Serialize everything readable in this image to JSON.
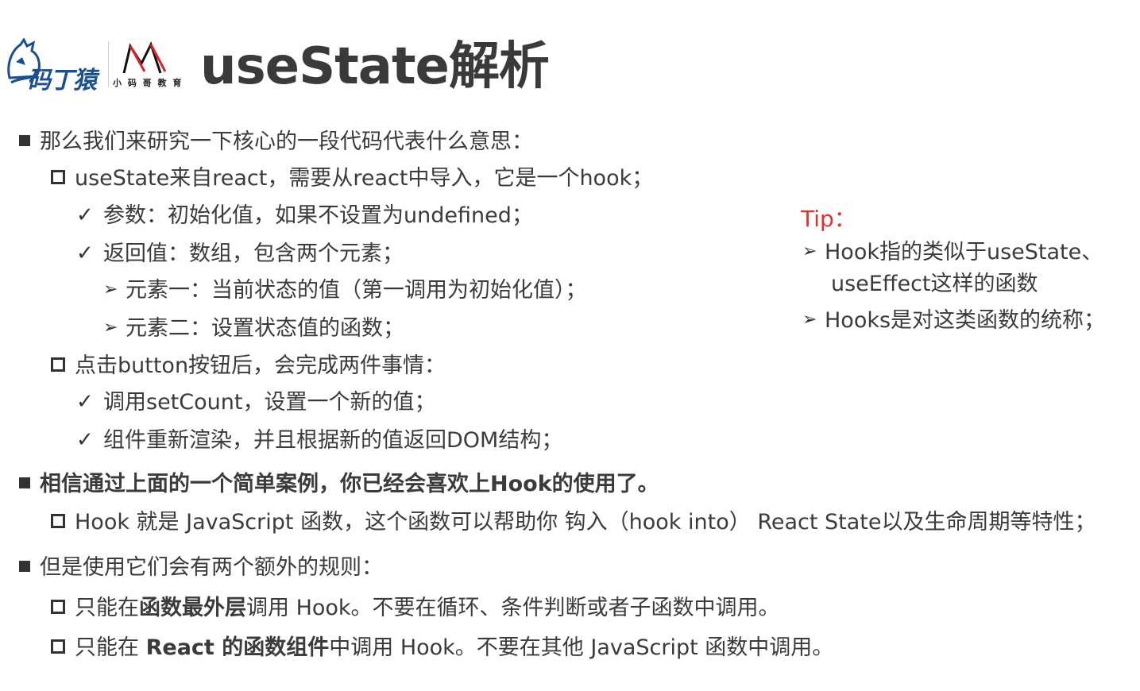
{
  "header": {
    "logo1_text": "码丁猿",
    "logo2_text": "小 码 哥 教 育",
    "title": "useState解析"
  },
  "items": [
    {
      "text": "那么我们来研究一下核心的一段代码代表什么意思："
    },
    {
      "text": "useState来自react，需要从react中导入，它是一个hook；"
    },
    {
      "text": "参数：初始化值，如果不设置为undefined；"
    },
    {
      "text": "返回值：数组，包含两个元素；"
    },
    {
      "text": "元素一：当前状态的值（第一调用为初始化值）；"
    },
    {
      "text": "元素二：设置状态值的函数；"
    },
    {
      "text": "点击button按钮后，会完成两件事情："
    },
    {
      "text": "调用setCount，设置一个新的值；"
    },
    {
      "text": "组件重新渲染，并且根据新的值返回DOM结构；"
    },
    {
      "text": "相信通过上面的一个简单案例，你已经会喜欢上Hook的使用了。"
    },
    {
      "text": "Hook 就是 JavaScript 函数，这个函数可以帮助你 钩入（hook into） React State以及生命周期等特性；"
    },
    {
      "text": "但是使用它们会有两个额外的规则："
    }
  ],
  "rule1": {
    "pre": "只能在",
    "bold": "函数最外层",
    "post": "调用 Hook。不要在循环、条件判断或者子函数中调用。"
  },
  "rule2": {
    "pre": "只能在 ",
    "bold": "React 的函数组件",
    "post": "中调用 Hook。不要在其他 JavaScript 函数中调用。"
  },
  "tip": {
    "title": "Tip：",
    "lines": [
      "Hook指的类似于useState、",
      "useEffect这样的函数",
      "Hooks是对这类函数的统称；"
    ]
  }
}
